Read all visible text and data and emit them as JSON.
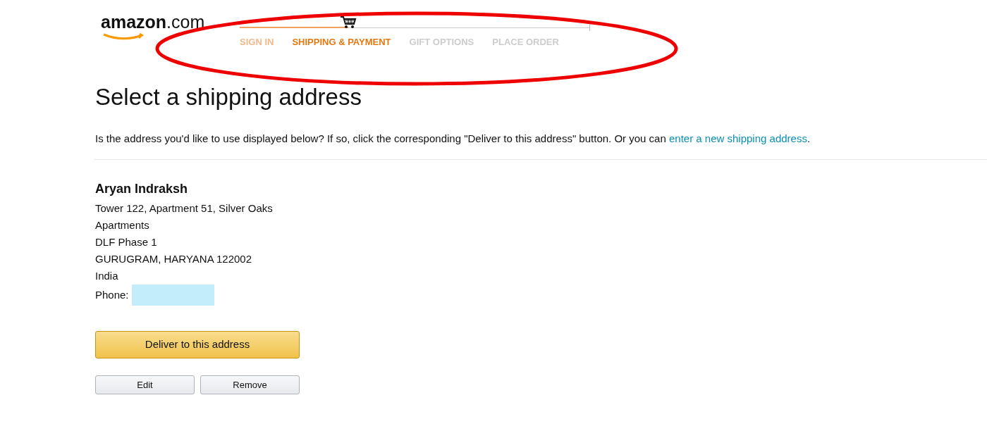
{
  "logo": {
    "text": "**amazon**.com"
  },
  "checkout_progress": {
    "level": 0.31,
    "steps": [
      {
        "label": "SIGN IN",
        "selected": false
      },
      {
        "label": "SHIPPING & PAYMENT",
        "selected": true
      },
      {
        "label": "GIFT OPTIONS",
        "selected": false
      },
      {
        "label": "PLACE ORDER",
        "selected": false
      }
    ]
  },
  "heading": "Select a shipping address",
  "intro": {
    "text": "Is the address you'd like to use displayed below? If so, click the corresponding \"Deliver to this address\" button. Or you can ",
    "link": "enter a new shipping address",
    "end": "."
  },
  "address": {
    "name": "Aryan Indraksh",
    "lines": [
      "Tower 122, Apartment 51, Silver Oaks",
      "Apartments",
      "DLF Phase 1",
      "GURUGRAM, HARYANA 122002",
      "India"
    ],
    "phone_label": "Phone:"
  },
  "buttons": {
    "primary": "Deliver to this address",
    "secondary": [
      "Edit",
      "Remove"
    ]
  }
}
